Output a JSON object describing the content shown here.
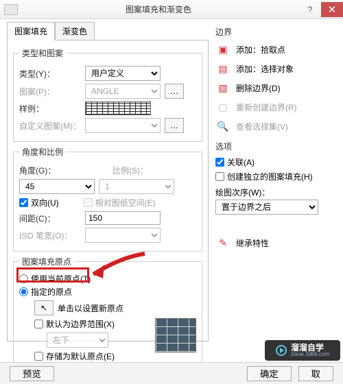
{
  "title": "图案填充和渐变色",
  "tabs": {
    "fill": "图案填充",
    "grad": "渐变色"
  },
  "groups": {
    "type": "类型和图案",
    "angle": "角度和比例",
    "origin": "图案填充原点"
  },
  "labels": {
    "type": "类型(Y)：",
    "pattern": "图案(P)：",
    "sample": "样例：",
    "custom": "自定义图案(M)：",
    "angle": "角度(G)：",
    "scale": "比例(S)：",
    "double": "双向(U)",
    "relpaper": "相对图纸空间(E)",
    "spacing": "间距(C)：",
    "isopen": "ISO 笔宽(O)：",
    "use_current": "使用当前原点(T)",
    "specify": "指定的原点",
    "click_set": "单击以设置新原点",
    "default_range": "默认为边界范围(X)",
    "range_pos": "左下",
    "store_default": "存储为默认原点(E)"
  },
  "values": {
    "type": "用户定义",
    "pattern": "ANGLE",
    "angle": "45",
    "scale": "1",
    "spacing": "150"
  },
  "right": {
    "boundary": "边界",
    "add_pick": "添加：拾取点",
    "add_sel": "添加：选择对象",
    "del_bound": "删除边界(D)",
    "recreate": "重新创建边界(R)",
    "view_sel": "查看选择集(V)",
    "options": "选项",
    "assoc": "关联(A)",
    "indep": "创建独立的图案填充(H)",
    "draw_order": "绘图次序(W)：",
    "draw_order_val": "置于边界之后",
    "inherit": "继承特性"
  },
  "buttons": {
    "preview": "预览",
    "ok": "确定",
    "cancel": "取"
  },
  "logo": {
    "brand": "溜溜自学",
    "site": "zixue.3d66.com"
  }
}
